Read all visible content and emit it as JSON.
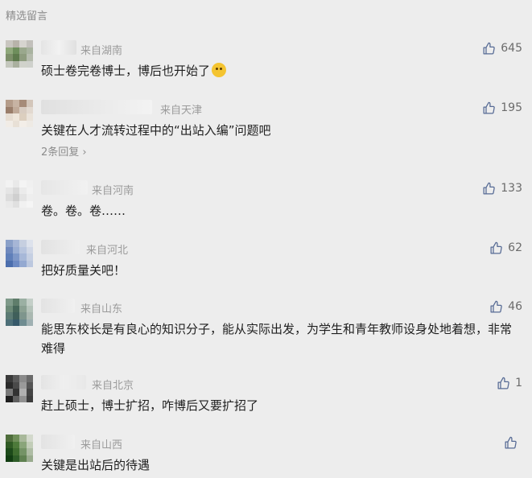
{
  "section_title": "精选留言",
  "colors": {
    "background": "#ededed",
    "text": "#1f1f1f",
    "meta": "#9b9b9b",
    "like_icon": "#576b95"
  },
  "comments": [
    {
      "location": "来自湖南",
      "content": "硕士卷完卷博士，博后也开始了",
      "emoji": "cat-face-emoji",
      "likes": "645"
    },
    {
      "location": "来自天津",
      "content": "关键在人才流转过程中的“出站入编”问题吧",
      "replies": "2条回复",
      "likes": "195"
    },
    {
      "location": "来自河南",
      "content": "卷。卷。卷……",
      "likes": "133"
    },
    {
      "location": "来自河北",
      "content": "把好质量关吧！",
      "likes": "62"
    },
    {
      "location": "来自山东",
      "content": "能思东校长是有良心的知识分子，能从实际出发，为学生和青年教师设身处地着想，非常难得",
      "likes": "46"
    },
    {
      "location": "来自北京",
      "content": "赶上硕士，博士扩招，咋博后又要扩招了",
      "likes": "1"
    },
    {
      "location": "来自山西",
      "content": "关键是出站后的待遇",
      "likes": ""
    }
  ]
}
